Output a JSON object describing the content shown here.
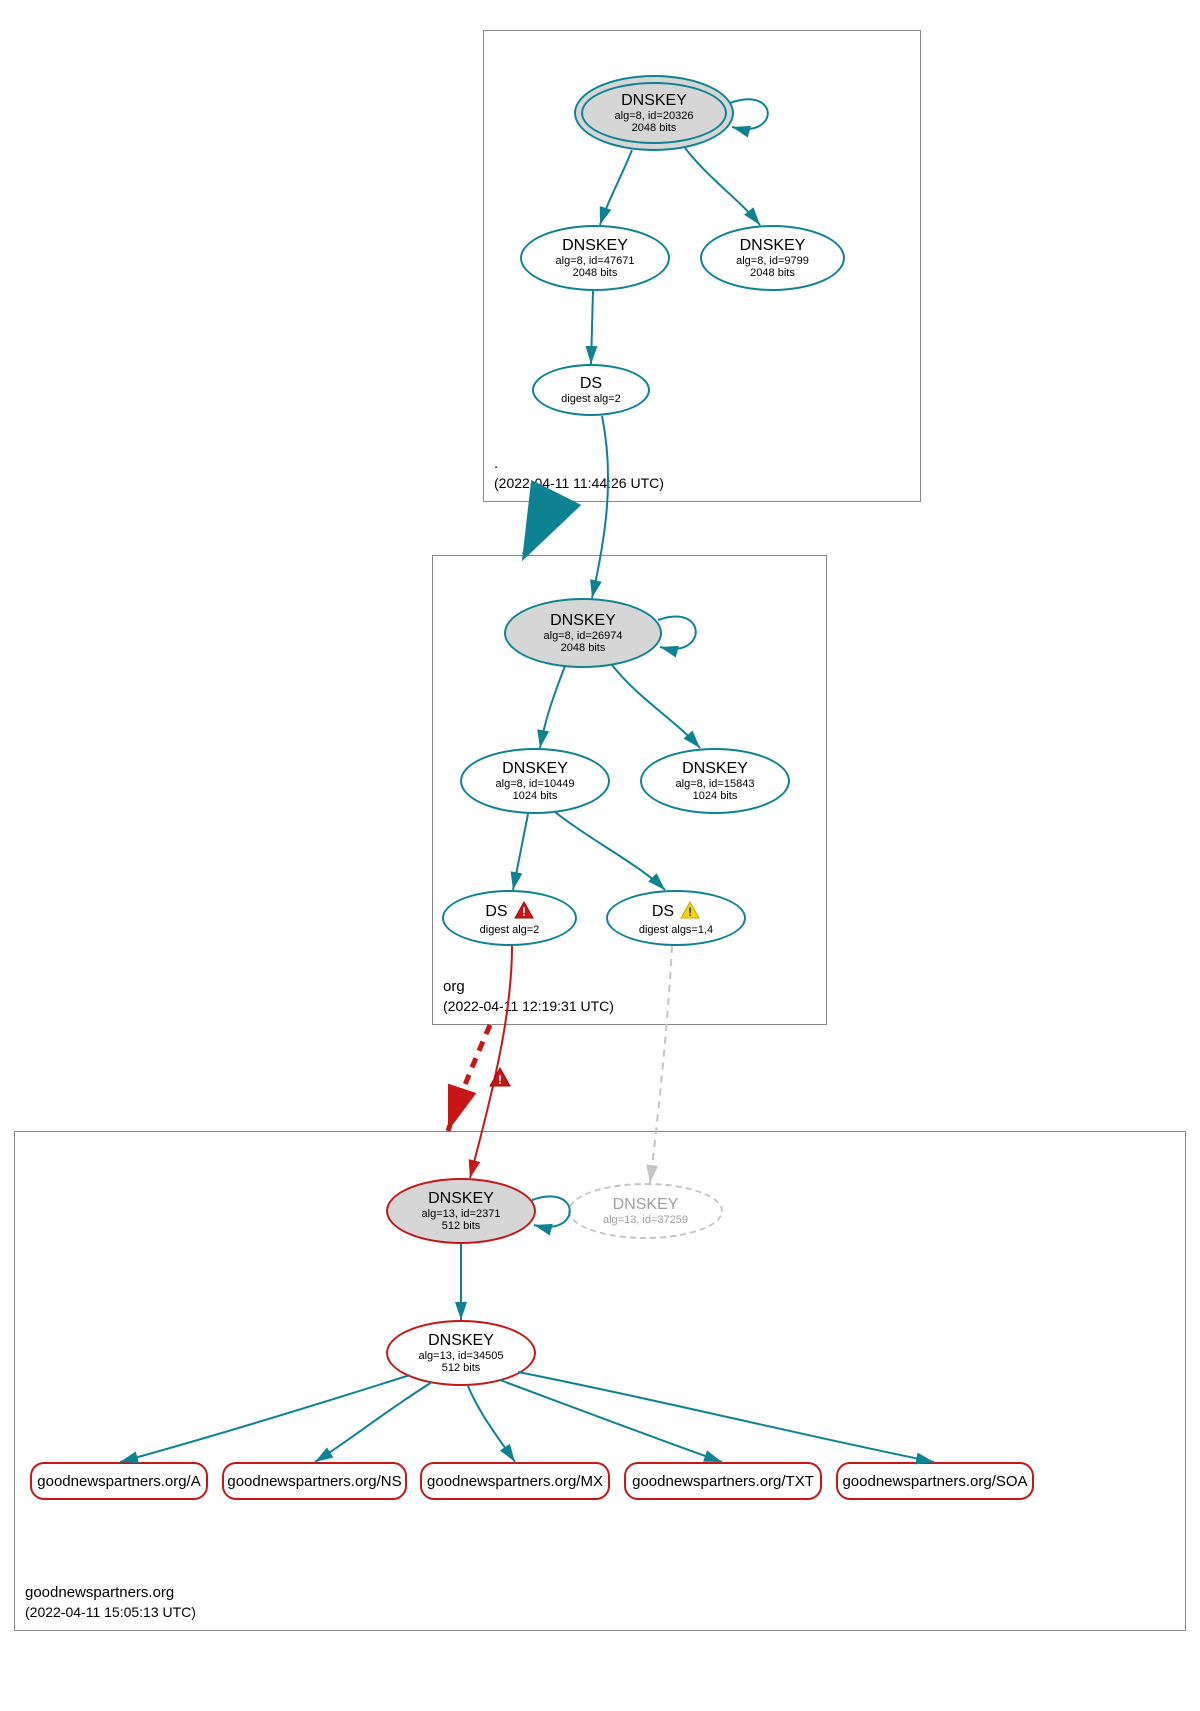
{
  "colors": {
    "teal": "#0d8293",
    "red": "#c81515",
    "yellow": "#f4d40e",
    "grey_fill": "#d6d6d6",
    "dashed_grey": "#c4c4c4"
  },
  "zones": {
    "root": {
      "label": ".",
      "timestamp": "(2022-04-11 11:44:26 UTC)",
      "nodes": {
        "dnskey_root_ksk": {
          "title": "DNSKEY",
          "sub1": "alg=8, id=20326",
          "sub2": "2048 bits"
        },
        "dnskey_root_47671": {
          "title": "DNSKEY",
          "sub1": "alg=8, id=47671",
          "sub2": "2048 bits"
        },
        "dnskey_root_9799": {
          "title": "DNSKEY",
          "sub1": "alg=8, id=9799",
          "sub2": "2048 bits"
        },
        "ds_root": {
          "title": "DS",
          "sub1": "digest alg=2"
        }
      }
    },
    "org": {
      "label": "org",
      "timestamp": "(2022-04-11 12:19:31 UTC)",
      "nodes": {
        "dnskey_org_26974": {
          "title": "DNSKEY",
          "sub1": "alg=8, id=26974",
          "sub2": "2048 bits"
        },
        "dnskey_org_10449": {
          "title": "DNSKEY",
          "sub1": "alg=8, id=10449",
          "sub2": "1024 bits"
        },
        "dnskey_org_15843": {
          "title": "DNSKEY",
          "sub1": "alg=8, id=15843",
          "sub2": "1024 bits"
        },
        "ds_org_1": {
          "title": "DS",
          "sub1": "digest alg=2",
          "warn": "red"
        },
        "ds_org_2": {
          "title": "DS",
          "sub1": "digest algs=1,4",
          "warn": "yellow"
        }
      }
    },
    "domain": {
      "label": "goodnewspartners.org",
      "timestamp": "(2022-04-11 15:05:13 UTC)",
      "nodes": {
        "dnskey_dom_2371": {
          "title": "DNSKEY",
          "sub1": "alg=13, id=2371",
          "sub2": "512 bits"
        },
        "dnskey_dom_37259": {
          "title": "DNSKEY",
          "sub1": "alg=13, id=37259"
        },
        "dnskey_dom_34505": {
          "title": "DNSKEY",
          "sub1": "alg=13, id=34505",
          "sub2": "512 bits"
        }
      },
      "rrsets": {
        "a": "goodnewspartners.org/A",
        "ns": "goodnewspartners.org/NS",
        "mx": "goodnewspartners.org/MX",
        "txt": "goodnewspartners.org/TXT",
        "soa": "goodnewspartners.org/SOA"
      }
    }
  },
  "warn_on_dashed_edge": "red"
}
